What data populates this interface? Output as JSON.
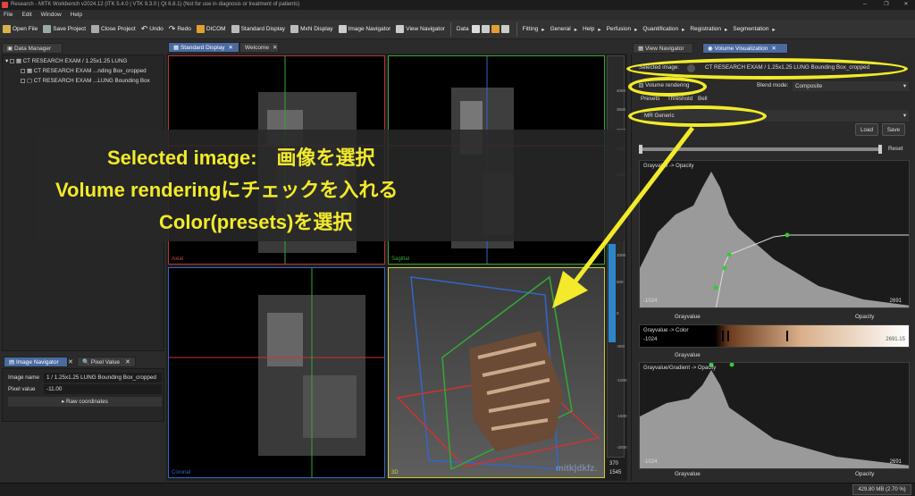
{
  "window": {
    "title": "Research - MITK Workbench v2024.12 (ITK 5.4.0 | VTK 9.3.0 | Qt 6.8.1) (Not for use in diagnosis or treatment of patients)",
    "minimize": "─",
    "maximize": "❐",
    "close": "✕"
  },
  "menu": [
    "File",
    "Edit",
    "Window",
    "Help"
  ],
  "toolbar": {
    "open_file": "Open File",
    "save_project": "Save Project",
    "close_project": "Close Project",
    "undo": "Undo",
    "redo": "Redo",
    "dicom": "DICOM",
    "standard_display": "Standard Display",
    "mxn_display": "MxN Display",
    "image_navigator": "Image Navigator",
    "view_navigator": "View Navigator",
    "data": "Data",
    "fitting": "Fitting",
    "general": "General",
    "help": "Help",
    "perfusion": "Perfusion",
    "quantification": "Quantification",
    "registration": "Registration",
    "segmentation": "Segmentation"
  },
  "data_manager": {
    "tab": "Data Manager",
    "items": [
      "CT RESEARCH EXAM / 1.25x1.25 LUNG",
      "CT RESEARCH EXAM ...nding Box_cropped",
      "CT RESEARCH EXAM ...LUNG Bounding Box"
    ]
  },
  "image_navigator": {
    "tab1": "Image Navigator",
    "tab2": "Pixel Value",
    "image_name_label": "Image name",
    "image_name_value": "1 / 1.25x1.25 LUNG Bounding Box_cropped",
    "pixel_value_label": "Pixel value",
    "pixel_value_value": "-11.00",
    "raw_coordinates": "Raw coordinates"
  },
  "viewer": {
    "tab_standard": "Standard Display",
    "tab_welcome": "Welcome",
    "axial": "Axial",
    "sagittal": "Sagittal",
    "coronal": "Coronal",
    "three_d": "3D",
    "logo": "mitk|dkfz.",
    "level_ticks": [
      "4000",
      "3500",
      "3000",
      "2500",
      "2000",
      "1500",
      "1000",
      "500",
      "0",
      "-500",
      "-1000",
      "-1500",
      "-2000"
    ],
    "level_value": "370",
    "window_value": "1545"
  },
  "right_panel": {
    "tab_view_nav": "View Navigator",
    "tab_volume_vis": "Volume Visualization",
    "selected_image_label": "Selected image:",
    "selected_image_value": "CT RESEARCH EXAM / 1.25x1.25 LUNG Bounding Box_cropped",
    "volume_rendering": "Volume rendering",
    "blend_mode_label": "Blend mode:",
    "blend_mode_value": "Composite",
    "tabs": [
      "Presets",
      "Threshold",
      "Bell"
    ],
    "preset_value": "MR Generic",
    "load": "Load",
    "save": "Save",
    "reset": "Reset",
    "graph1_title": "Grayvalue -> Opacity",
    "graph1_min": "-1024",
    "graph1_max": "2691",
    "axis1_left": "Grayvalue",
    "axis1_right": "Opacity",
    "color_title": "Grayvalue -> Color",
    "color_min": "-1024",
    "color_max": "2691.15",
    "axis2": "Grayvalue",
    "graph2_title": "Grayvalue/Gradient -> Opacity",
    "graph2_min": "-1024",
    "graph2_max": "2691",
    "axis3_left": "Grayvalue",
    "axis3_right": "Opacity"
  },
  "annotation": {
    "line1": "Selected image:　画像を選択",
    "line2": "Volume renderingにチェックを入れる",
    "line3": "Color(presets)を選択",
    "color": "#f2ea2a"
  },
  "status": {
    "memory": "429.80 MB (2.70 %)"
  }
}
